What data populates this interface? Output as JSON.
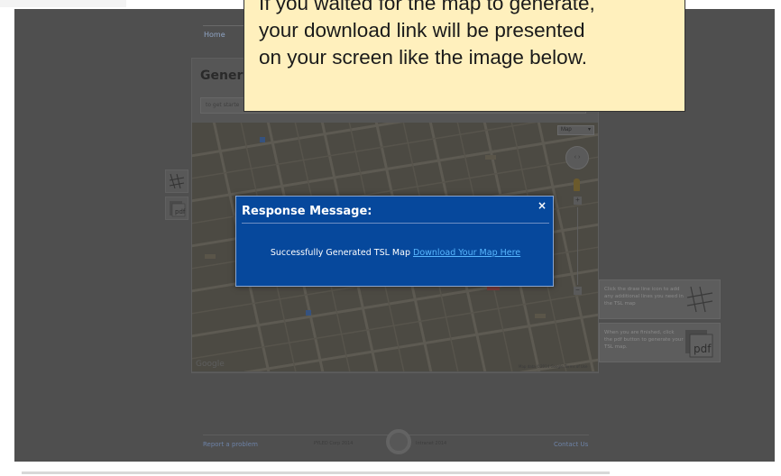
{
  "callout": {
    "lines": [
      "If you waited for the map to generate,",
      "your download link will be presented",
      "on your screen like the image below."
    ]
  },
  "nav": {
    "home": "Home"
  },
  "panel": {
    "title": "Genera",
    "input_placeholder": "to get starte"
  },
  "map": {
    "type_label": "Map",
    "google_label": "Google",
    "attribution": "Map data ©2014 Google   Terms of Use"
  },
  "modal": {
    "title": "Response Message:",
    "close": "×",
    "message": "Successfully Generated TSL Map ",
    "link_text": "Download Your Map Here"
  },
  "hints": {
    "draw": "Click the draw line icon to add any additional lines you need in the TSL map",
    "pdf": "When you are finished, click the pdf button to generate your TSL map."
  },
  "tools": {
    "pdf_label": "pdf"
  },
  "footer": {
    "report": "Report a problem",
    "copy1": "PYLED Corp 2014",
    "copy2": "Intranet 2014",
    "contact": "Contact Us"
  },
  "colors": {
    "overlay": "#4f4f4f",
    "modal_bg": "#06489c",
    "link": "#58b7ff",
    "callout_bg": "#fff0bd"
  }
}
